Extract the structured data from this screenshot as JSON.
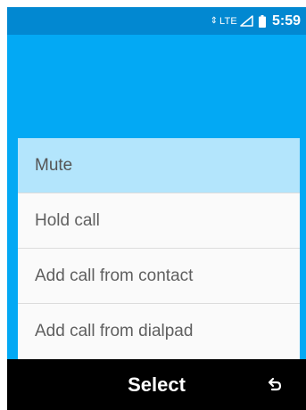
{
  "status_bar": {
    "data_arrows": "⇕",
    "network": "LTE",
    "signal_icon": "signal-icon",
    "battery_icon": "battery-icon",
    "time": "5:59"
  },
  "menu": {
    "items": [
      {
        "label": "Mute",
        "selected": true
      },
      {
        "label": "Hold call",
        "selected": false
      },
      {
        "label": "Add call from contact",
        "selected": false
      },
      {
        "label": "Add call from dialpad",
        "selected": false
      }
    ]
  },
  "softkeys": {
    "center_label": "Select",
    "right_icon": "back-icon"
  },
  "colors": {
    "status_bar": "#0288d1",
    "background": "#03a9f4",
    "selected_item": "#b3e5fc",
    "softkey_bar": "#000000"
  }
}
